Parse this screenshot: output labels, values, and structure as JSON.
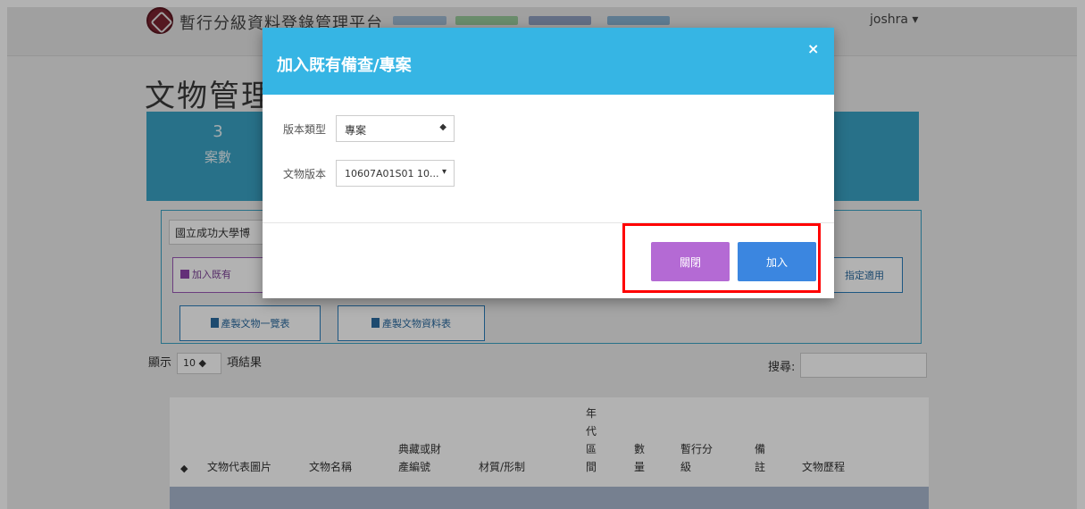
{
  "navbar": {
    "brand": "暫行分級資料登錄管理平台",
    "user": "joshra ▾"
  },
  "page": {
    "title": "文物管理"
  },
  "stats": {
    "count": "3",
    "label": "案數"
  },
  "filter": {
    "institution": "國立成功大學博",
    "add_existing_label": "加入既有",
    "designate_label": "指定適用",
    "export_list_label": "產製文物一覽表",
    "export_data_label": "產製文物資料表"
  },
  "table_controls": {
    "show_prefix": "顯示",
    "page_length": "10",
    "show_suffix": "項結果",
    "search_label": "搜尋:"
  },
  "table": {
    "headers": [
      "文物代表圖片",
      "文物名稱",
      "典藏或財\n產編號",
      "材質/形制",
      "年\n代\n區\n間",
      "數\n量",
      "暫行分\n級",
      "備\n註",
      "文物歷程"
    ]
  },
  "modal": {
    "title": "加入既有備查/專案",
    "close_icon": "×",
    "version_type_label": "版本類型",
    "version_type_value": "專案",
    "version_type_caret": "◆",
    "cultural_version_label": "文物版本",
    "cultural_version_value": "10607A01S01 10...",
    "cultural_version_caret": "▾",
    "close_button": "關閉",
    "add_button": "加入"
  },
  "colors": {
    "header": "#36b5e4",
    "close_button": "#b46ad4",
    "add_button": "#3b86e0",
    "highlight": "#ff0000"
  }
}
